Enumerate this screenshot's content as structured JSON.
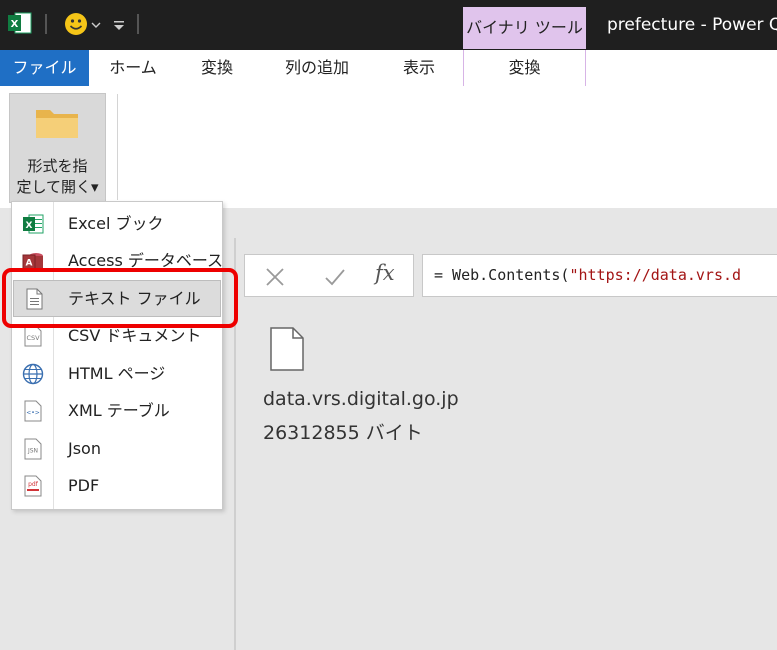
{
  "titlebar": {
    "app_icon": "excel-icon",
    "context_tab_group": "バイナリ ツール",
    "window_title": "prefecture - Power Q"
  },
  "tabs": {
    "file": "ファイル",
    "home": "ホーム",
    "transform": "変換",
    "add_column": "列の追加",
    "view": "表示",
    "binary_transform": "変換"
  },
  "ribbon": {
    "open_as_label": "形式を指\n定して開く▾"
  },
  "menu": {
    "items": [
      {
        "label": "Excel ブック",
        "icon": "excel-icon"
      },
      {
        "label": "Access データベース",
        "icon": "access-icon"
      },
      {
        "label": "テキスト ファイル",
        "icon": "text-file-icon"
      },
      {
        "label": "CSV ドキュメント",
        "icon": "csv-icon"
      },
      {
        "label": "HTML ページ",
        "icon": "globe-icon"
      },
      {
        "label": "XML テーブル",
        "icon": "xml-icon"
      },
      {
        "label": "Json",
        "icon": "json-icon"
      },
      {
        "label": "PDF",
        "icon": "pdf-icon"
      }
    ]
  },
  "formula": {
    "fx": "fx",
    "prefix": "= Web.Contents(",
    "string": "\"https://data.vrs.d"
  },
  "binary": {
    "file_name": "data.vrs.digital.go.jp",
    "file_size": "26312855 バイト"
  },
  "colors": {
    "file_tab": "#1f6fc5",
    "context_tab": "#e0c4ec",
    "highlight": "#ee0000",
    "string": "#a31515"
  }
}
